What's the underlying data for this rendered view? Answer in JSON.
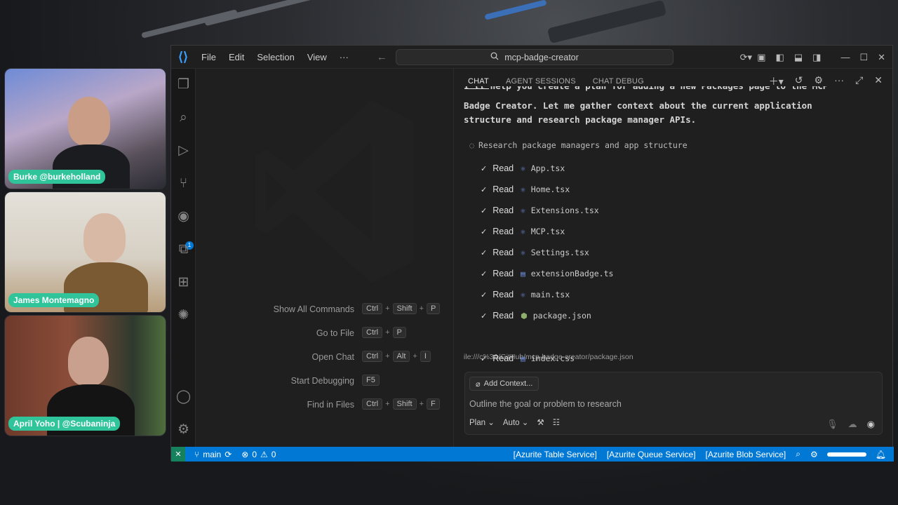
{
  "participants": [
    {
      "name": "Burke @burkeholland"
    },
    {
      "name": "James Montemagno"
    },
    {
      "name": "April Yoho | @Scubaninja"
    }
  ],
  "window": {
    "menu": [
      "File",
      "Edit",
      "Selection",
      "View",
      "···"
    ],
    "search_text": "mcp-badge-creator"
  },
  "activity_bar": {
    "icons": [
      "explorer-icon",
      "search-icon",
      "run-debug-icon",
      "source-control-icon",
      "copilot-icon",
      "remote-explorer-icon",
      "extensions-icon",
      "openai-icon",
      "account-icon",
      "settings-icon"
    ],
    "badge": "1"
  },
  "editor": {
    "shortcuts": [
      {
        "label": "Show All Commands",
        "keys": [
          "Ctrl",
          "Shift",
          "P"
        ]
      },
      {
        "label": "Go to File",
        "keys": [
          "Ctrl",
          "P"
        ]
      },
      {
        "label": "Open Chat",
        "keys": [
          "Ctrl",
          "Alt",
          "I"
        ]
      },
      {
        "label": "Start Debugging",
        "keys": [
          "F5"
        ]
      },
      {
        "label": "Find in Files",
        "keys": [
          "Ctrl",
          "Shift",
          "F"
        ]
      }
    ]
  },
  "chat": {
    "tabs": [
      "CHAT",
      "AGENT SESSIONS",
      "CHAT DEBUG"
    ],
    "intro_partial": "I'll help you create a plan for adding a new Packages page to the MCP",
    "intro_line2": "Badge Creator. Let me gather context about the current application",
    "intro_line3": "structure and research package manager APIs.",
    "task": "Research package managers and app structure",
    "read_label": "Read",
    "files": [
      "App.tsx",
      "Home.tsx",
      "Extensions.tsx",
      "MCP.tsx",
      "Settings.tsx",
      "extensionBadge.ts",
      "main.tsx",
      "package.json",
      "index.css"
    ],
    "hover_link": "file:///c%3A/GitHub/mcp-badge-creator/package.json",
    "add_context": "Add Context...",
    "placeholder": "Outline the goal or problem to research",
    "mode": "Plan",
    "model": "Auto"
  },
  "status_bar": {
    "branch": "main",
    "errors": "0",
    "warnings": "0",
    "services": [
      "[Azurite Table Service]",
      "[Azurite Queue Service]",
      "[Azurite Blob Service]"
    ]
  }
}
